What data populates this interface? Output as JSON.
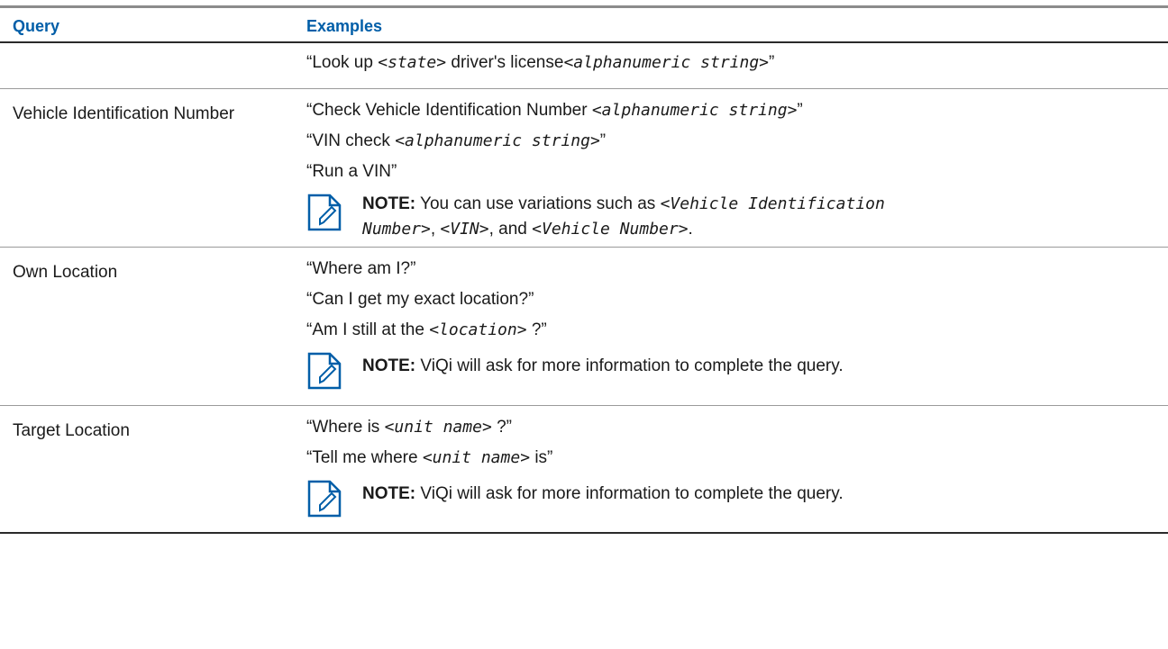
{
  "header": {
    "query": "Query",
    "examples": "Examples"
  },
  "rows": [
    {
      "query": "",
      "examples": [
        {
          "pre": "“Look up ",
          "v1": "<state>",
          "mid": " driver's license",
          "v2": "<alphanumeric string>",
          "post": "”"
        }
      ]
    },
    {
      "query": "Vehicle Identification Number",
      "examples": [
        {
          "pre": "“Check Vehicle Identification Number ",
          "v1": "<alphanumeric string>",
          "post": "”"
        },
        {
          "pre": "“VIN check ",
          "v1": "<alphanumeric string>",
          "post": "”"
        },
        {
          "text": "“Run a VIN”"
        }
      ],
      "note": {
        "label": "NOTE:",
        "t1": " You can use variations such as ",
        "v1": "<Vehicle Identification",
        "v1b": "Number>",
        "sep1": ", ",
        "v2": "<VIN>",
        "sep2": ", and ",
        "v3": "<Vehicle Number>",
        "end": "."
      }
    },
    {
      "query": "Own Location",
      "examples": [
        {
          "text": "“Where am I?”"
        },
        {
          "text": "“Can I get my exact location?”"
        },
        {
          "pre": "“Am I still at the ",
          "v1": "<location>",
          "post": " ?”"
        }
      ],
      "note": {
        "label": "NOTE:",
        "text": " ViQi will ask for more information to complete the query."
      }
    },
    {
      "query": "Target Location",
      "examples": [
        {
          "pre": "“Where is ",
          "v1": "<unit name>",
          "post": " ?”"
        },
        {
          "pre": "“Tell me where ",
          "v1": "<unit name>",
          "post": " is”"
        }
      ],
      "note": {
        "label": "NOTE:",
        "text": " ViQi will ask for more information to complete the query."
      }
    }
  ],
  "icons": {
    "note": "note-icon"
  },
  "colors": {
    "header_text": "#005ea8",
    "rule": "#2a2a2a"
  }
}
